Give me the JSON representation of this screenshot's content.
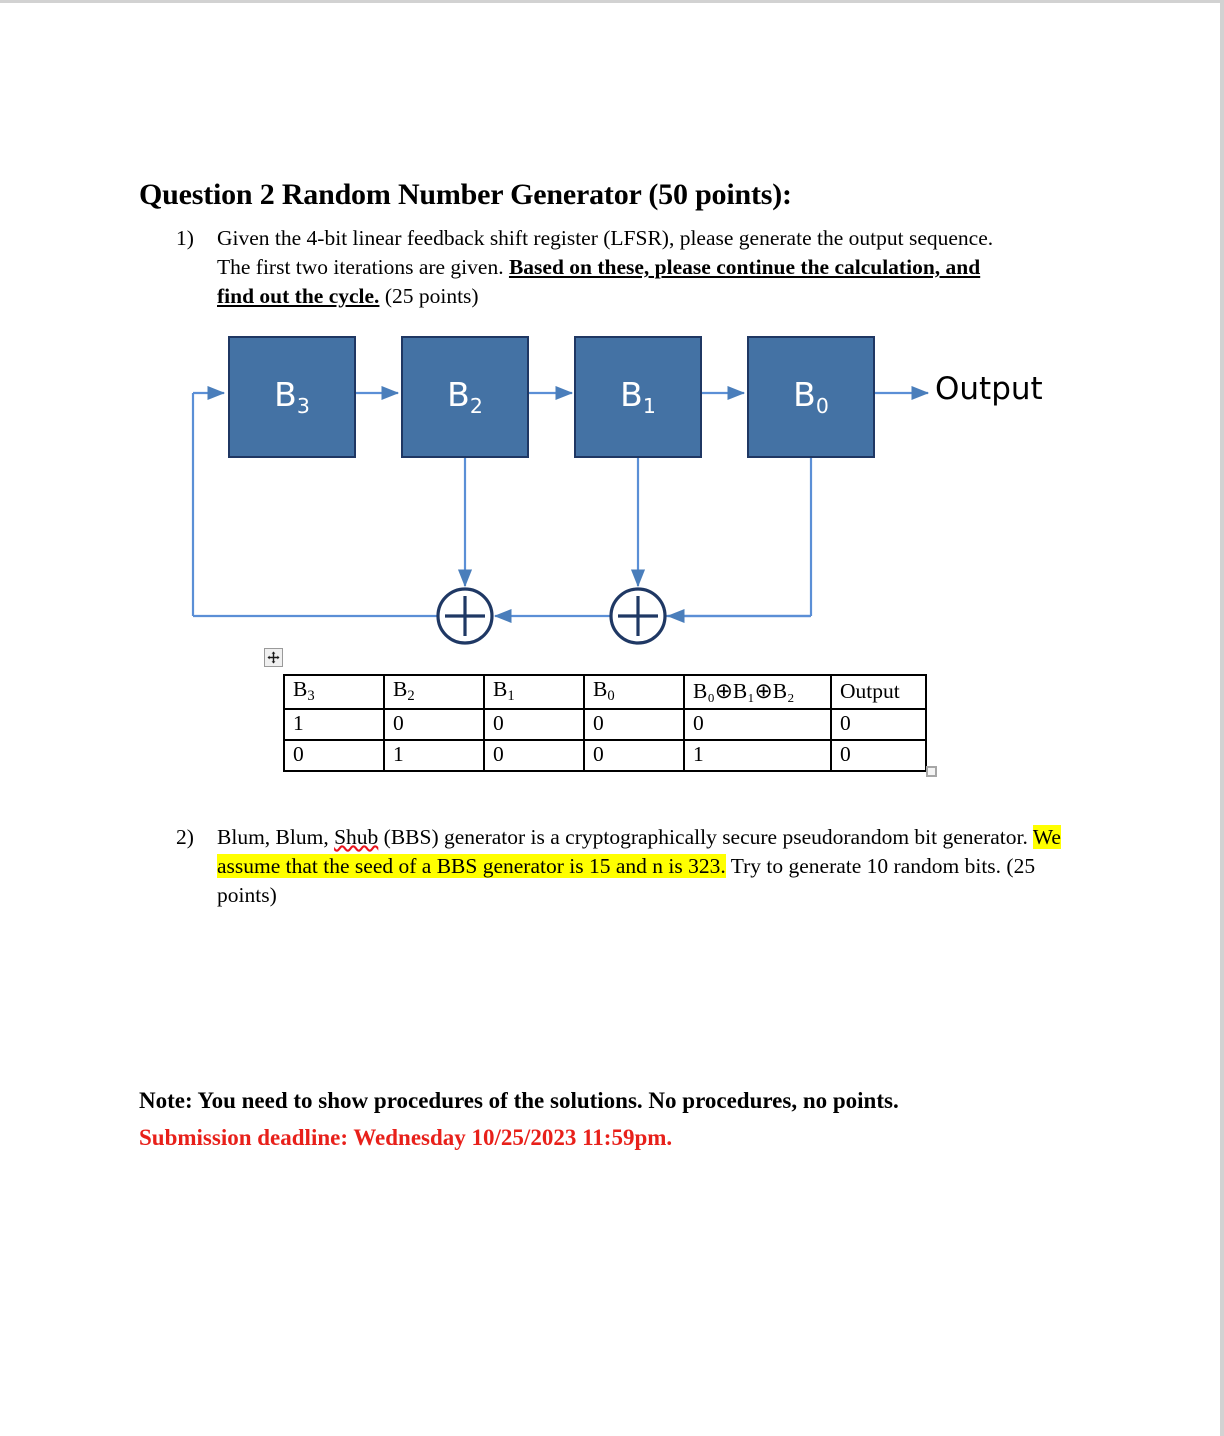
{
  "document": {
    "heading": "Question 2 Random Number Generator (50 points):",
    "items": [
      {
        "number": "1)",
        "text_part_1": "Given the 4-bit linear feedback shift register (LFSR), please generate the output sequence. The first two iterations are given. ",
        "emphasis": "Based on these, please continue the calculation, and find out the cycle.",
        "text_part_2": " (25 points)"
      },
      {
        "number": "2)",
        "text_part_1": "Blum, Blum, ",
        "misspelled": "Shub",
        "text_part_2": " (BBS) generator is a cryptographically secure pseudorandom bit generator. ",
        "highlight": "We assume that the seed of a BBS generator is 15 and n is 323.",
        "text_part_3": " Try to generate 10 random bits. (25 points)"
      }
    ],
    "notes": {
      "line_1": "Note: You need to show procedures of the solutions. No procedures, no points.",
      "line_2": "Submission deadline: Wednesday 10/25/2023 11:59pm."
    }
  },
  "diagram": {
    "registers": [
      {
        "label": "B",
        "sub": "3"
      },
      {
        "label": "B",
        "sub": "2"
      },
      {
        "label": "B",
        "sub": "1"
      },
      {
        "label": "B",
        "sub": "0"
      }
    ],
    "output_label": "Output",
    "xor_gates": [
      "xor-left",
      "xor-right"
    ],
    "colors": {
      "box_fill": "#4472A4",
      "box_border": "#1f3763",
      "wire": "#5B8FD6",
      "xor_border": "#1F3864"
    }
  },
  "table": {
    "headers": [
      {
        "text": "B",
        "sub": "3"
      },
      {
        "text": "B",
        "sub": "2"
      },
      {
        "text": "B",
        "sub": "1"
      },
      {
        "text": "B",
        "sub": "0"
      },
      {
        "text": "XOR",
        "sub": ""
      },
      {
        "text": "Output",
        "sub": ""
      }
    ],
    "xor_header": "B₀⊕B₁⊕B₂",
    "rows": [
      [
        "1",
        "0",
        "0",
        "0",
        "0",
        "0"
      ],
      [
        "0",
        "1",
        "0",
        "0",
        "1",
        "0"
      ]
    ]
  },
  "handles": {
    "move": "table-move-handle",
    "resize": "table-resize-handle"
  }
}
